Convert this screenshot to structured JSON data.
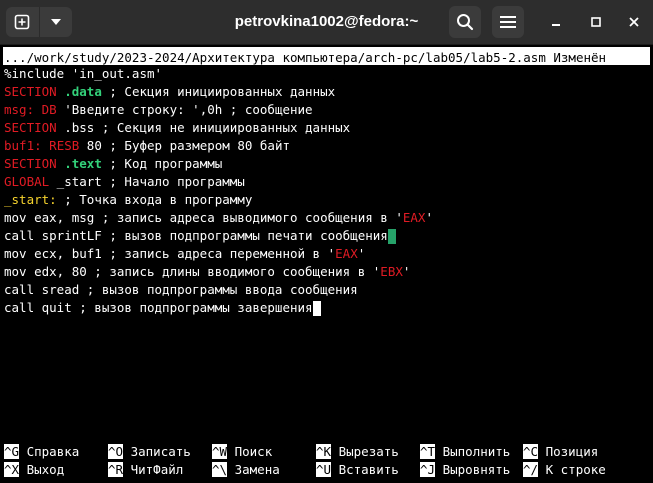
{
  "window": {
    "title": "petrovkina1002@fedora:~"
  },
  "editor": {
    "header_text": ".../work/study/2023-2024/Архитектура компьютера/arch-pc/lab05/lab5-2.asm Изменён",
    "lines": [
      [
        {
          "t": "%include 'in_out.asm'",
          "c": "white"
        }
      ],
      [
        {
          "t": "SECTION ",
          "c": "red"
        },
        {
          "t": ".data",
          "c": "green"
        },
        {
          "t": " ; Секция инициированных данных",
          "c": "white"
        }
      ],
      [
        {
          "t": "msg:",
          "c": "red"
        },
        {
          "t": " ",
          "c": "white"
        },
        {
          "t": "DB",
          "c": "red"
        },
        {
          "t": " 'Введите строку: ',0h ; сообщение",
          "c": "white"
        }
      ],
      [
        {
          "t": "SECTION",
          "c": "red"
        },
        {
          "t": " .bss ; Секция не инициированных данных",
          "c": "white"
        }
      ],
      [
        {
          "t": "buf1:",
          "c": "red"
        },
        {
          "t": " ",
          "c": "white"
        },
        {
          "t": "RESB",
          "c": "red"
        },
        {
          "t": " 80 ; Буфер размером 80 байт",
          "c": "white"
        }
      ],
      [
        {
          "t": "SECTION ",
          "c": "red"
        },
        {
          "t": ".text",
          "c": "green"
        },
        {
          "t": " ; Код программы",
          "c": "white"
        }
      ],
      [
        {
          "t": "GLOBAL",
          "c": "red"
        },
        {
          "t": " _start ; Начало программы",
          "c": "white"
        }
      ],
      [
        {
          "t": "_start:",
          "c": "yellow"
        },
        {
          "t": " ; Точка входа в программу",
          "c": "white"
        }
      ],
      [
        {
          "t": "mov eax, msg ; запись адреса выводимого сообщения в '",
          "c": "white"
        },
        {
          "t": "EAX",
          "c": "red"
        },
        {
          "t": "'",
          "c": "white"
        }
      ],
      [
        {
          "t": "call sprintLF ; вызов подпрограммы печати сообщения",
          "c": "white"
        },
        {
          "t": "",
          "c": "cursor-green"
        }
      ],
      [
        {
          "t": "mov ecx, buf1 ; запись адреса переменной в '",
          "c": "white"
        },
        {
          "t": "EAX",
          "c": "red"
        },
        {
          "t": "'",
          "c": "white"
        }
      ],
      [
        {
          "t": "mov edx, 80 ; запись длины вводимого сообщения в '",
          "c": "white"
        },
        {
          "t": "EBX",
          "c": "red"
        },
        {
          "t": "'",
          "c": "white"
        }
      ],
      [
        {
          "t": "call sread ; вызов подпрограммы ввода сообщения",
          "c": "white"
        }
      ],
      [
        {
          "t": "call quit ; вызов подпрограммы завершения",
          "c": "white"
        },
        {
          "t": "",
          "c": "cursor-white"
        }
      ]
    ]
  },
  "shortcuts": [
    {
      "key": "^G",
      "label": "Справка"
    },
    {
      "key": "^O",
      "label": "Записать"
    },
    {
      "key": "^W",
      "label": "Поиск"
    },
    {
      "key": "^K",
      "label": "Вырезать"
    },
    {
      "key": "^T",
      "label": "Выполнить"
    },
    {
      "key": "^C",
      "label": "Позиция"
    },
    {
      "key": "^X",
      "label": "Выход"
    },
    {
      "key": "^R",
      "label": "ЧитФайл"
    },
    {
      "key": "^\\",
      "label": "Замена"
    },
    {
      "key": "^U",
      "label": "Вставить"
    },
    {
      "key": "^J",
      "label": "Выровнять"
    },
    {
      "key": "^/",
      "label": "К строке"
    }
  ],
  "colors": {
    "titlebar": "#2d2d2d",
    "keyword_red": "#e01b24",
    "label_yellow": "#f6d32d",
    "section_green": "#33d17a",
    "cursor_green": "#26a269"
  },
  "icons": {
    "new_tab": "plus-square-icon",
    "menu_dropdown": "chevron-down-icon",
    "search": "search-icon",
    "hamburger": "hamburger-menu-icon",
    "minimize": "minimize-icon",
    "maximize": "maximize-icon",
    "close": "close-icon"
  }
}
